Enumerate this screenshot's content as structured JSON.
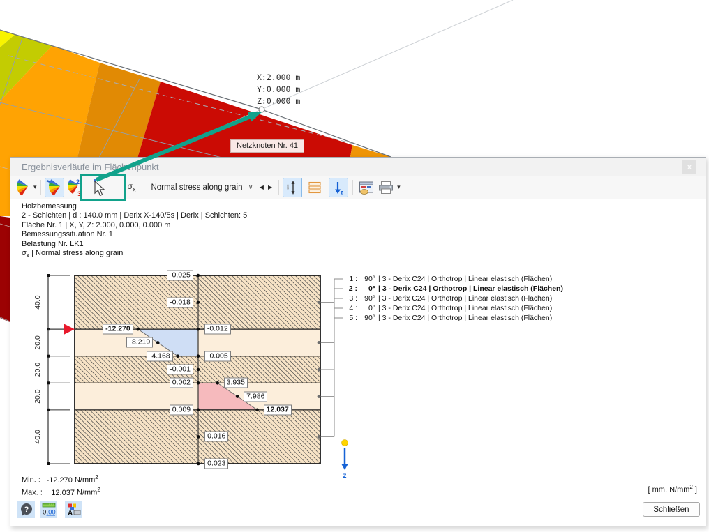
{
  "window": {
    "title": "Ergebnisverläufe im Flächenpunkt",
    "close_label": "x"
  },
  "scene": {
    "coordinates": [
      "X:2.000 m",
      "Y:0.000 m",
      "Z:0.000 m"
    ],
    "tooltip": "Netzknoten Nr. 41",
    "band_colors": {
      "yellow": "#f8f400",
      "yellow_green": "#c3cc02",
      "orange": "#ffa303",
      "dark_orange": "#e18a04",
      "red": "#cb0b04",
      "dark_red": "#9c0203",
      "edge_orange": "#ef9405"
    },
    "annotation_color": "#12a28b"
  },
  "toolbar": {
    "sigma": "σ",
    "sigma_sub": "x",
    "result_dropdown": "Normal stress along grain",
    "prev_arrow": "◀",
    "next_arrow": "▶",
    "chevron": "∨",
    "caret": "▾",
    "icons": [
      "results-fan",
      "results-surface-fan",
      "results-fan-23",
      "select-pointer",
      "section-height-toggle",
      "layers-toggle",
      "z-direction-toggle",
      "report-printout",
      "printer"
    ]
  },
  "info_lines": [
    "Holzbemessung",
    "2 - Schichten | d : 140.0 mm | Derix X-140/5s | Derix | Schichten: 5",
    "Fläche Nr. 1 | X, Y, Z: 2.000, 0.000, 0.000 m",
    "Bemessungssituation Nr. 1",
    "Belastung Nr. LK1"
  ],
  "info_sigma_line": {
    "sigma": "σ",
    "sub": "x",
    "rest": " | Normal stress along grain"
  },
  "chart_data": {
    "type": "layer-stress-profile",
    "title": "σx | Normal stress along grain",
    "units": "mm, N/mm2",
    "total_thickness_mm": 140.0,
    "layers": [
      {
        "num": 1,
        "thickness_mm": 40.0,
        "thickness_label": "40.0",
        "angle": "90°",
        "hatched": true
      },
      {
        "num": 2,
        "thickness_mm": 20.0,
        "thickness_label": "20.0",
        "angle": "0°",
        "hatched": false
      },
      {
        "num": 3,
        "thickness_mm": 20.0,
        "thickness_label": "20.0",
        "angle": "90°",
        "hatched": true
      },
      {
        "num": 4,
        "thickness_mm": 20.0,
        "thickness_label": "20.0",
        "angle": "0°",
        "hatched": false
      },
      {
        "num": 5,
        "thickness_mm": 40.0,
        "thickness_label": "40.0",
        "angle": "90°",
        "hatched": true
      }
    ],
    "points": [
      {
        "layer": 1,
        "pos": "top",
        "value": -0.025,
        "label": "-0.025",
        "side": "left",
        "bold": false
      },
      {
        "layer": 1,
        "pos": "mid",
        "value": -0.018,
        "label": "-0.018",
        "side": "left",
        "bold": false
      },
      {
        "layer": 2,
        "pos": "top",
        "value": -12.27,
        "label": "-12.270",
        "side": "left",
        "bold": true
      },
      {
        "layer": 1,
        "pos": "bottom",
        "value": -0.012,
        "label": "-0.012",
        "side": "right",
        "bold": false
      },
      {
        "layer": 2,
        "pos": "mid",
        "value": -8.219,
        "label": "-8.219",
        "side": "left",
        "bold": false
      },
      {
        "layer": 2,
        "pos": "bottom",
        "value": -4.168,
        "label": "-4.168",
        "side": "left",
        "bold": false
      },
      {
        "layer": 3,
        "pos": "top",
        "value": -0.005,
        "label": "-0.005",
        "side": "right",
        "bold": false
      },
      {
        "layer": 3,
        "pos": "mid",
        "value": -0.001,
        "label": "-0.001",
        "side": "left",
        "bold": false
      },
      {
        "layer": 3,
        "pos": "bottom",
        "value": 0.002,
        "label": "0.002",
        "side": "left",
        "bold": false
      },
      {
        "layer": 4,
        "pos": "top",
        "value": 3.935,
        "label": "3.935",
        "side": "right",
        "bold": false
      },
      {
        "layer": 4,
        "pos": "mid",
        "value": 7.986,
        "label": "7.986",
        "side": "right",
        "bold": false
      },
      {
        "layer": 4,
        "pos": "bottom",
        "value": 12.037,
        "label": "12.037",
        "side": "right",
        "bold": true
      },
      {
        "layer": 5,
        "pos": "top",
        "value": 0.009,
        "label": "0.009",
        "side": "left",
        "bold": false
      },
      {
        "layer": 5,
        "pos": "mid",
        "value": 0.016,
        "label": "0.016",
        "side": "right",
        "bold": false
      },
      {
        "layer": 5,
        "pos": "bottom",
        "value": 0.023,
        "label": "0.023",
        "side": "right",
        "bold": false
      }
    ],
    "regions": [
      {
        "layer": 2,
        "top_value": -12.27,
        "bottom_value": -4.168,
        "fill": "#cfdef5"
      },
      {
        "layer": 4,
        "top_value": 3.935,
        "bottom_value": 12.037,
        "fill": "#f6babd"
      }
    ],
    "marker_boundary": 1,
    "min": -12.27,
    "max": 12.037
  },
  "legend": {
    "rows": [
      {
        "num": "1 :",
        "angle": "90°",
        "text": "| 3 - Derix C24 | Orthotrop | Linear elastisch (Flächen)",
        "bold": false
      },
      {
        "num": "2 :",
        "angle": "0°",
        "text": "| 3 - Derix C24 | Orthotrop | Linear elastisch (Flächen)",
        "bold": true
      },
      {
        "num": "3 :",
        "angle": "90°",
        "text": "| 3 - Derix C24 | Orthotrop | Linear elastisch (Flächen)",
        "bold": false
      },
      {
        "num": "4 :",
        "angle": "0°",
        "text": "| 3 - Derix C24 | Orthotrop | Linear elastisch (Flächen)",
        "bold": false
      },
      {
        "num": "5 :",
        "angle": "90°",
        "text": "| 3 - Derix C24 | Orthotrop | Linear elastisch (Flächen)",
        "bold": false
      }
    ]
  },
  "footer": {
    "min_label": "Min. :",
    "min_value": "-12.270",
    "max_label": "Max. :",
    "max_value": "12.037",
    "unit": "N/mm",
    "unit_sup": "2",
    "units_note_prefix": "[ mm, N/mm",
    "units_note_sup": "2",
    "units_note_suffix": " ]",
    "close_button": "Schließen"
  }
}
